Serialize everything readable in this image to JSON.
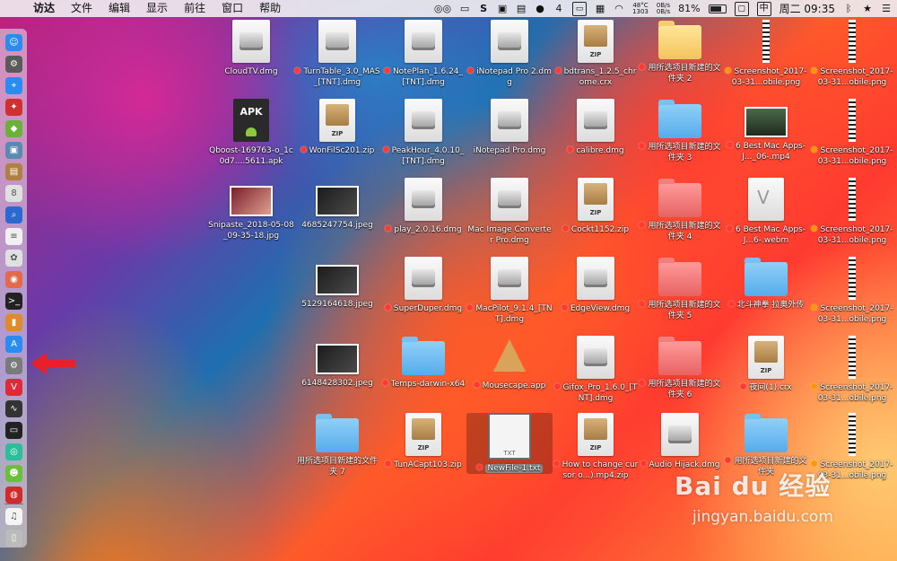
{
  "menubar": {
    "apple": "",
    "app_name": "访达",
    "items": [
      "文件",
      "编辑",
      "显示",
      "前往",
      "窗口",
      "帮助"
    ],
    "status": {
      "s_label": "S",
      "badge_count": "4",
      "cpu_temp": "48°C",
      "cpu_value": "1303",
      "net_up": "0B/s",
      "net_down": "0B/s",
      "battery": "81%",
      "input_label": "中",
      "datetime": "周二 09:35"
    }
  },
  "dock": {
    "icons": [
      "finder-icon",
      "launchpad-icon",
      "safari-icon",
      "app-red-icon",
      "android-icon",
      "preview-icon",
      "notes-icon",
      "calendar-icon",
      "search-app-icon",
      "textedit-icon",
      "photos-icon",
      "photos-wheel-icon",
      "terminal-icon",
      "books-icon",
      "appstore-icon",
      "system-preferences-icon",
      "vivaldi-icon",
      "activity-monitor-icon",
      "terminal-dark-icon",
      "messenger-icon",
      "wechat-icon",
      "netease-music-icon",
      "itunes-icon",
      "trash-icon"
    ]
  },
  "files": [
    {
      "name": "CloudTV.dmg",
      "type": "dmg",
      "tag": ""
    },
    {
      "name": "TurnTable_3.0_MAS_[TNT].dmg",
      "type": "dmg",
      "tag": "red"
    },
    {
      "name": "NotePlan_1.6.24_[TNT].dmg",
      "type": "dmg",
      "tag": "red"
    },
    {
      "name": "iNotepad Pro 2.dmg",
      "type": "dmg",
      "tag": "red"
    },
    {
      "name": "bdtrans_1.2.5_chrome.crx",
      "type": "zip",
      "tag": "red"
    },
    {
      "name": "用所选项目新建的文件夹 2",
      "type": "folder-yellow",
      "tag": "red"
    },
    {
      "name": "Screenshot_2017-03-31...obile.png",
      "type": "strip",
      "tag": "orange"
    },
    {
      "name": "Screenshot_2017-03-31...obile.png",
      "type": "strip",
      "tag": "orange"
    },
    {
      "name": "Qboost-169763-o_1c0d7....5611.apk",
      "type": "apk",
      "tag": ""
    },
    {
      "name": "WonFilSc201.zip",
      "type": "zip",
      "tag": "red"
    },
    {
      "name": "PeakHour_4.0.10_[TNT].dmg",
      "type": "dmg",
      "tag": "red"
    },
    {
      "name": "iNotepad Pro.dmg",
      "type": "dmg",
      "tag": ""
    },
    {
      "name": "calibre.dmg",
      "type": "dmg",
      "tag": "red"
    },
    {
      "name": "用所选项目新建的文件夹 3",
      "type": "folder-blue",
      "tag": "red"
    },
    {
      "name": "6 Best Mac Apps- J..._06-.mp4",
      "type": "thumb-land",
      "tag": "red"
    },
    {
      "name": "Screenshot_2017-03-31...obile.png",
      "type": "strip",
      "tag": "orange"
    },
    {
      "name": "Snipaste_2018-05-08_09-35-18.jpg",
      "type": "thumb-screen",
      "tag": ""
    },
    {
      "name": "4685247754.jpeg",
      "type": "thumb-dark",
      "tag": ""
    },
    {
      "name": "play_2.0.16.dmg",
      "type": "dmg",
      "tag": "red"
    },
    {
      "name": "Mac Image Converter Pro.dmg",
      "type": "dmg",
      "tag": ""
    },
    {
      "name": "Cockt1152.zip",
      "type": "zip",
      "tag": "red"
    },
    {
      "name": "用所选项目新建的文件夹 4",
      "type": "folder-red",
      "tag": "red"
    },
    {
      "name": "6 Best Mac Apps- J...6-.webm",
      "type": "video",
      "tag": "red"
    },
    {
      "name": "Screenshot_2017-03-31...obile.png",
      "type": "strip",
      "tag": "orange"
    },
    {
      "name": "5129164618.jpeg",
      "type": "thumb-dark",
      "tag": ""
    },
    {
      "name": "SuperDuper.dmg",
      "type": "dmg",
      "tag": "red"
    },
    {
      "name": "MacPilot_9.1.4_[TNT].dmg",
      "type": "dmg",
      "tag": "red"
    },
    {
      "name": "EdgeView.dmg",
      "type": "dmg",
      "tag": "red"
    },
    {
      "name": "用所选项目新建的文件夹 5",
      "type": "folder-red",
      "tag": "red"
    },
    {
      "name": "北斗神拳 拉奥外传",
      "type": "folder-blue",
      "tag": "red"
    },
    {
      "name": "Screenshot_2017-03-31...obile.png",
      "type": "strip",
      "tag": "orange"
    },
    {
      "name": "6148428302.jpeg",
      "type": "thumb-dark",
      "tag": ""
    },
    {
      "name": "Temps-darwin-x64",
      "type": "folder-blue",
      "tag": "red"
    },
    {
      "name": "Mousecape.app",
      "type": "app",
      "tag": "red"
    },
    {
      "name": "Gifox_Pro_1.6.0_[TNT].dmg",
      "type": "dmg",
      "tag": "red"
    },
    {
      "name": "用所选项目新建的文件夹 6",
      "type": "folder-red",
      "tag": "red"
    },
    {
      "name": "夜间(1).crx",
      "type": "zip",
      "tag": "red"
    },
    {
      "name": "Screenshot_2017-03-31...obile.png",
      "type": "strip",
      "tag": "orange"
    },
    {
      "name": "用所选项目新建的文件夹 7",
      "type": "folder-blue",
      "tag": ""
    },
    {
      "name": "TunACapt103.zip",
      "type": "zip",
      "tag": "red"
    },
    {
      "name": "NewFile-1.txt",
      "type": "txt",
      "tag": "red"
    },
    {
      "name": "How to change cursor o...).mp4.zip",
      "type": "zip",
      "tag": "red"
    },
    {
      "name": "Audio Hijack.dmg",
      "type": "dmg",
      "tag": "red"
    },
    {
      "name": "用所选项目新建的文件夹",
      "type": "folder-blue",
      "tag": "red"
    },
    {
      "name": "Screenshot_2017-03-31...obile.png",
      "type": "strip",
      "tag": "orange"
    }
  ],
  "icon_text": {
    "zip": "ZIP",
    "apk": "APK",
    "txt": "TXT"
  },
  "watermark": {
    "logo": "Bai du 经验",
    "url": "jingyan.baidu.com"
  }
}
